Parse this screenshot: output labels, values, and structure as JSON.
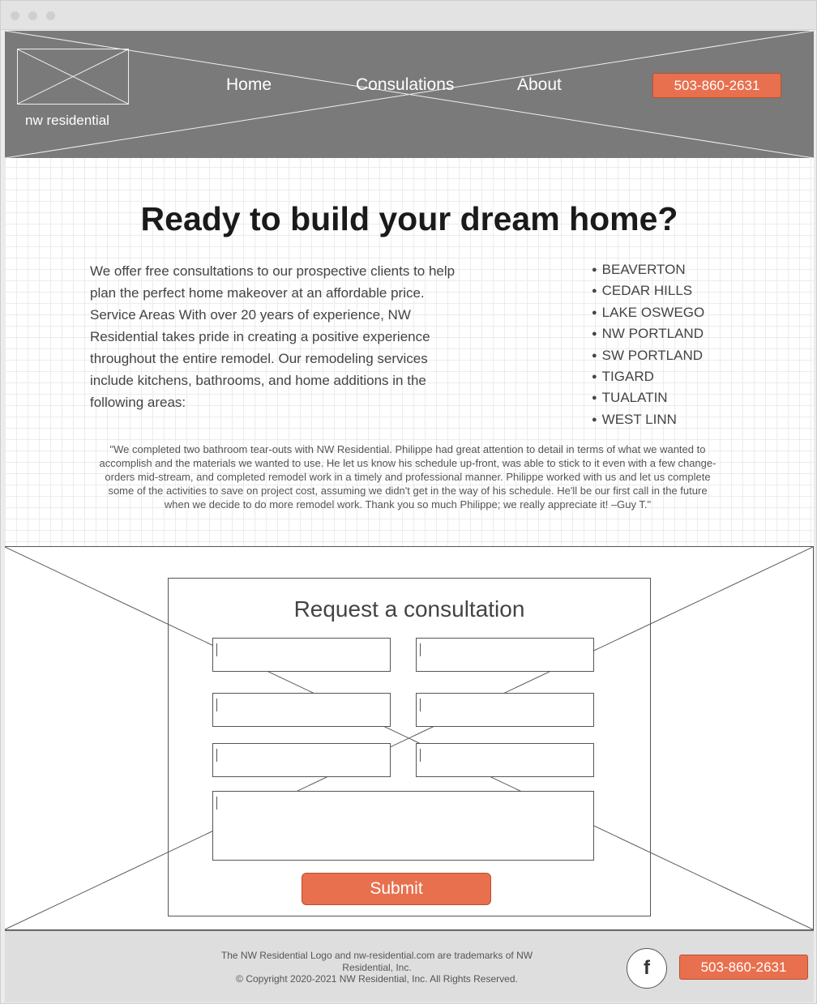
{
  "header": {
    "logo_text": "nw residential",
    "nav": [
      "Home",
      "Consulations",
      "About"
    ],
    "phone": "503-860-2631"
  },
  "hero": {
    "headline": "Ready to build your dream home?",
    "intro": "We offer free consultations to our prospective clients to help plan the perfect home makeover at an affordable price. Service Areas With over 20 years of experience, NW Residential takes pride in creating a positive experience throughout the entire remodel. Our remodeling services include kitchens, bathrooms, and home additions in the following areas:",
    "service_areas": [
      "BEAVERTON",
      "CEDAR HILLS",
      "LAKE OSWEGO",
      "NW PORTLAND",
      "SW PORTLAND",
      "TIGARD",
      "TUALATIN",
      "WEST LINN"
    ]
  },
  "testimonial": {
    "text": "\"We completed two bathroom tear-outs with NW Residential. Philippe had great attention to detail in terms of what we wanted to accomplish and the materials we wanted to use. He let us know his schedule up-front, was able to stick to it even with a few change-orders mid-stream, and completed remodel work in a timely and professional manner. Philippe worked with us and let us complete some of the activities to save on project cost, assuming we didn't get in the way of his schedule. He'll be our first call in the future when we decide to do more remodel work. Thank you so much Philippe; we really appreciate it! –Guy T.\""
  },
  "form": {
    "title": "Request a consultation",
    "submit_label": "Submit"
  },
  "footer": {
    "trademark": "The NW Residential Logo and nw-residential.com are trademarks of NW Residential, Inc.",
    "copyright": "© Copyright 2020-2021 NW Residential, Inc. All Rights Reserved.",
    "facebook_icon": "f",
    "phone": "503-860-2631"
  },
  "colors": {
    "accent": "#e8704e",
    "header_bg": "#7a7a7a",
    "footer_bg": "#dedede"
  }
}
